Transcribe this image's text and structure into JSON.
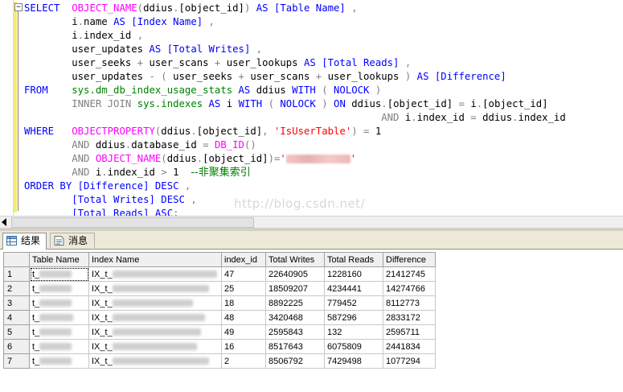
{
  "editor": {
    "lines": [
      [
        [
          "kw",
          "SELECT  "
        ],
        [
          "fn",
          "OBJECT_NAME"
        ],
        [
          "op",
          "("
        ],
        [
          "t",
          "ddius"
        ],
        [
          "op",
          "."
        ],
        [
          "t",
          "[object_id]"
        ],
        [
          "op",
          ")"
        ],
        [
          "t",
          " "
        ],
        [
          "kw",
          "AS"
        ],
        [
          "t",
          " "
        ],
        [
          "kw",
          "[Table Name]"
        ],
        [
          "t",
          " "
        ],
        [
          "op",
          ","
        ]
      ],
      [
        [
          "t",
          "        i"
        ],
        [
          "op",
          "."
        ],
        [
          "t",
          "name "
        ],
        [
          "kw",
          "AS"
        ],
        [
          "t",
          " "
        ],
        [
          "kw",
          "[Index Name]"
        ],
        [
          "t",
          " "
        ],
        [
          "op",
          ","
        ]
      ],
      [
        [
          "t",
          "        i"
        ],
        [
          "op",
          "."
        ],
        [
          "t",
          "index_id "
        ],
        [
          "op",
          ","
        ]
      ],
      [
        [
          "t",
          "        user_updates "
        ],
        [
          "kw",
          "AS"
        ],
        [
          "t",
          " "
        ],
        [
          "kw",
          "[Total Writes]"
        ],
        [
          "t",
          " "
        ],
        [
          "op",
          ","
        ]
      ],
      [
        [
          "t",
          "        user_seeks "
        ],
        [
          "op",
          "+"
        ],
        [
          "t",
          " user_scans "
        ],
        [
          "op",
          "+"
        ],
        [
          "t",
          " user_lookups "
        ],
        [
          "kw",
          "AS"
        ],
        [
          "t",
          " "
        ],
        [
          "kw",
          "[Total Reads]"
        ],
        [
          "t",
          " "
        ],
        [
          "op",
          ","
        ]
      ],
      [
        [
          "t",
          "        user_updates "
        ],
        [
          "op",
          "-"
        ],
        [
          "t",
          " "
        ],
        [
          "op",
          "("
        ],
        [
          "t",
          " user_seeks "
        ],
        [
          "op",
          "+"
        ],
        [
          "t",
          " user_scans "
        ],
        [
          "op",
          "+"
        ],
        [
          "t",
          " user_lookups "
        ],
        [
          "op",
          ")"
        ],
        [
          "t",
          " "
        ],
        [
          "kw",
          "AS"
        ],
        [
          "t",
          " "
        ],
        [
          "kw",
          "[Difference]"
        ]
      ],
      [
        [
          "kw",
          "FROM    "
        ],
        [
          "sys",
          "sys.dm_db_index_usage_stats"
        ],
        [
          "t",
          " "
        ],
        [
          "kw",
          "AS"
        ],
        [
          "t",
          " ddius "
        ],
        [
          "kw",
          "WITH"
        ],
        [
          "t",
          " "
        ],
        [
          "op",
          "("
        ],
        [
          "t",
          " "
        ],
        [
          "kw",
          "NOLOCK"
        ],
        [
          "t",
          " "
        ],
        [
          "op",
          ")"
        ]
      ],
      [
        [
          "t",
          "        "
        ],
        [
          "op",
          "INNER JOIN"
        ],
        [
          "t",
          " "
        ],
        [
          "sys",
          "sys.indexes"
        ],
        [
          "t",
          " "
        ],
        [
          "kw",
          "AS"
        ],
        [
          "t",
          " i "
        ],
        [
          "kw",
          "WITH"
        ],
        [
          "t",
          " "
        ],
        [
          "op",
          "("
        ],
        [
          "t",
          " "
        ],
        [
          "kw",
          "NOLOCK"
        ],
        [
          "t",
          " "
        ],
        [
          "op",
          ")"
        ],
        [
          "t",
          " "
        ],
        [
          "kw",
          "ON"
        ],
        [
          "t",
          " ddius"
        ],
        [
          "op",
          "."
        ],
        [
          "t",
          "[object_id] "
        ],
        [
          "op",
          "="
        ],
        [
          "t",
          " i"
        ],
        [
          "op",
          "."
        ],
        [
          "t",
          "[object_id]"
        ]
      ],
      [
        [
          "t",
          "                                                            "
        ],
        [
          "op",
          "AND"
        ],
        [
          "t",
          " i"
        ],
        [
          "op",
          "."
        ],
        [
          "t",
          "index_id "
        ],
        [
          "op",
          "="
        ],
        [
          "t",
          " ddius"
        ],
        [
          "op",
          "."
        ],
        [
          "t",
          "index_id"
        ]
      ],
      [
        [
          "kw",
          "WHERE   "
        ],
        [
          "fn",
          "OBJECTPROPERTY"
        ],
        [
          "op",
          "("
        ],
        [
          "t",
          "ddius"
        ],
        [
          "op",
          "."
        ],
        [
          "t",
          "[object_id]"
        ],
        [
          "op",
          ","
        ],
        [
          "t",
          " "
        ],
        [
          "str",
          "'IsUserTable'"
        ],
        [
          "op",
          ")"
        ],
        [
          "t",
          " "
        ],
        [
          "op",
          "="
        ],
        [
          "t",
          " 1"
        ]
      ],
      [
        [
          "t",
          "        "
        ],
        [
          "op",
          "AND"
        ],
        [
          "t",
          " ddius"
        ],
        [
          "op",
          "."
        ],
        [
          "t",
          "database_id "
        ],
        [
          "op",
          "="
        ],
        [
          "t",
          " "
        ],
        [
          "fn",
          "DB_ID"
        ],
        [
          "op",
          "()"
        ]
      ],
      [
        [
          "t",
          "        "
        ],
        [
          "op",
          "AND"
        ],
        [
          "t",
          " "
        ],
        [
          "fn",
          "OBJECT_NAME"
        ],
        [
          "op",
          "("
        ],
        [
          "t",
          "ddius"
        ],
        [
          "op",
          "."
        ],
        [
          "t",
          "[object_id]"
        ],
        [
          "op",
          ")="
        ],
        [
          "str",
          "'"
        ],
        [
          "blur",
          ""
        ],
        [
          "str",
          "'"
        ]
      ],
      [
        [
          "t",
          "        "
        ],
        [
          "op",
          "AND"
        ],
        [
          "t",
          " i"
        ],
        [
          "op",
          "."
        ],
        [
          "t",
          "index_id "
        ],
        [
          "op",
          ">"
        ],
        [
          "t",
          " 1  "
        ],
        [
          "cm",
          "--非聚集索引"
        ]
      ],
      [
        [
          "kw",
          "ORDER BY"
        ],
        [
          "t",
          " "
        ],
        [
          "kw",
          "[Difference]"
        ],
        [
          "t",
          " "
        ],
        [
          "kw",
          "DESC"
        ],
        [
          "t",
          " "
        ],
        [
          "op",
          ","
        ]
      ],
      [
        [
          "t",
          "        "
        ],
        [
          "kw",
          "[Total Writes]"
        ],
        [
          "t",
          " "
        ],
        [
          "kw",
          "DESC"
        ],
        [
          "t",
          " "
        ],
        [
          "op",
          ","
        ]
      ],
      [
        [
          "t",
          "        "
        ],
        [
          "kw",
          "[Total Reads]"
        ],
        [
          "t",
          " "
        ],
        [
          "kw",
          "ASC"
        ],
        [
          "op",
          ";"
        ]
      ]
    ],
    "watermark": "http://blog.csdn.net/"
  },
  "tabs": {
    "results_label": "结果",
    "messages_label": "消息",
    "results_icon": "grid-icon",
    "messages_icon": "messages-icon"
  },
  "grid": {
    "columns": [
      "Table Name",
      "Index Name",
      "index_id",
      "Total Writes",
      "Total Reads",
      "Difference"
    ],
    "rows": [
      {
        "num": "1",
        "table": "t_",
        "index": "IX_t_",
        "index_id": "47",
        "writes": "22640905",
        "reads": "1228160",
        "diff": "21412745"
      },
      {
        "num": "2",
        "table": "t_",
        "index": "IX_t_",
        "index_id": "25",
        "writes": "18509207",
        "reads": "4234441",
        "diff": "14274766"
      },
      {
        "num": "3",
        "table": "t_",
        "index": "IX_t_",
        "index_id": "18",
        "writes": "8892225",
        "reads": "779452",
        "diff": "8112773"
      },
      {
        "num": "4",
        "table": "t_",
        "index": "IX_t_",
        "index_id": "48",
        "writes": "3420468",
        "reads": "587296",
        "diff": "2833172"
      },
      {
        "num": "5",
        "table": "t_",
        "index": "IX_t_",
        "index_id": "49",
        "writes": "2595843",
        "reads": "132",
        "diff": "2595711"
      },
      {
        "num": "6",
        "table": "t_",
        "index": "IX_t_",
        "index_id": "16",
        "writes": "8517643",
        "reads": "6075809",
        "diff": "2441834"
      },
      {
        "num": "7",
        "table": "t_",
        "index": "IX_t_",
        "index_id": "2",
        "writes": "8506792",
        "reads": "7429498",
        "diff": "1077294"
      }
    ]
  }
}
